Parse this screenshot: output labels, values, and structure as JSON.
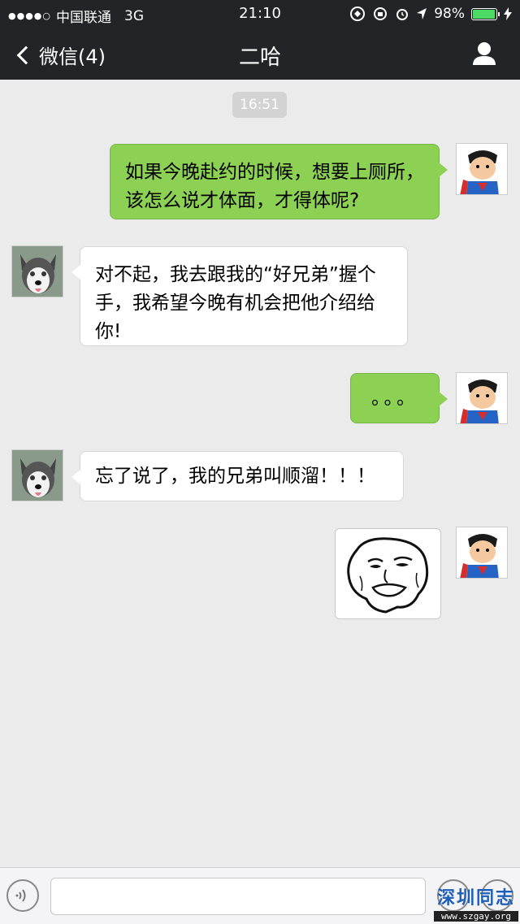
{
  "status_bar": {
    "carrier": "中国联通",
    "network": "3G",
    "time": "21:10",
    "battery": "98%",
    "battery_level": 0.98
  },
  "nav": {
    "back_label": "微信(4)",
    "title": "二哈"
  },
  "chat": {
    "timestamp": "16:51",
    "messages": [
      {
        "sender": "me",
        "text": "如果今晚赴约的时候，想要上厕所，该怎么说才体面，才得体呢?"
      },
      {
        "sender": "them",
        "text": "对不起，我去跟我的“好兄弟”握个手，我希望今晚有机会把他介绍给你!"
      },
      {
        "sender": "me",
        "text": "。。。"
      },
      {
        "sender": "them",
        "text": "忘了说了，我的兄弟叫顺溜！！！"
      },
      {
        "sender": "me",
        "type": "image",
        "icon": "troll-face-sticker"
      }
    ]
  },
  "watermark": {
    "title": "深圳同志",
    "url": "www.szgay.org"
  },
  "colors": {
    "bar": "#222427",
    "my_bubble": "#8cd153",
    "their_bubble": "#ffffff",
    "background": "#ebebeb"
  }
}
